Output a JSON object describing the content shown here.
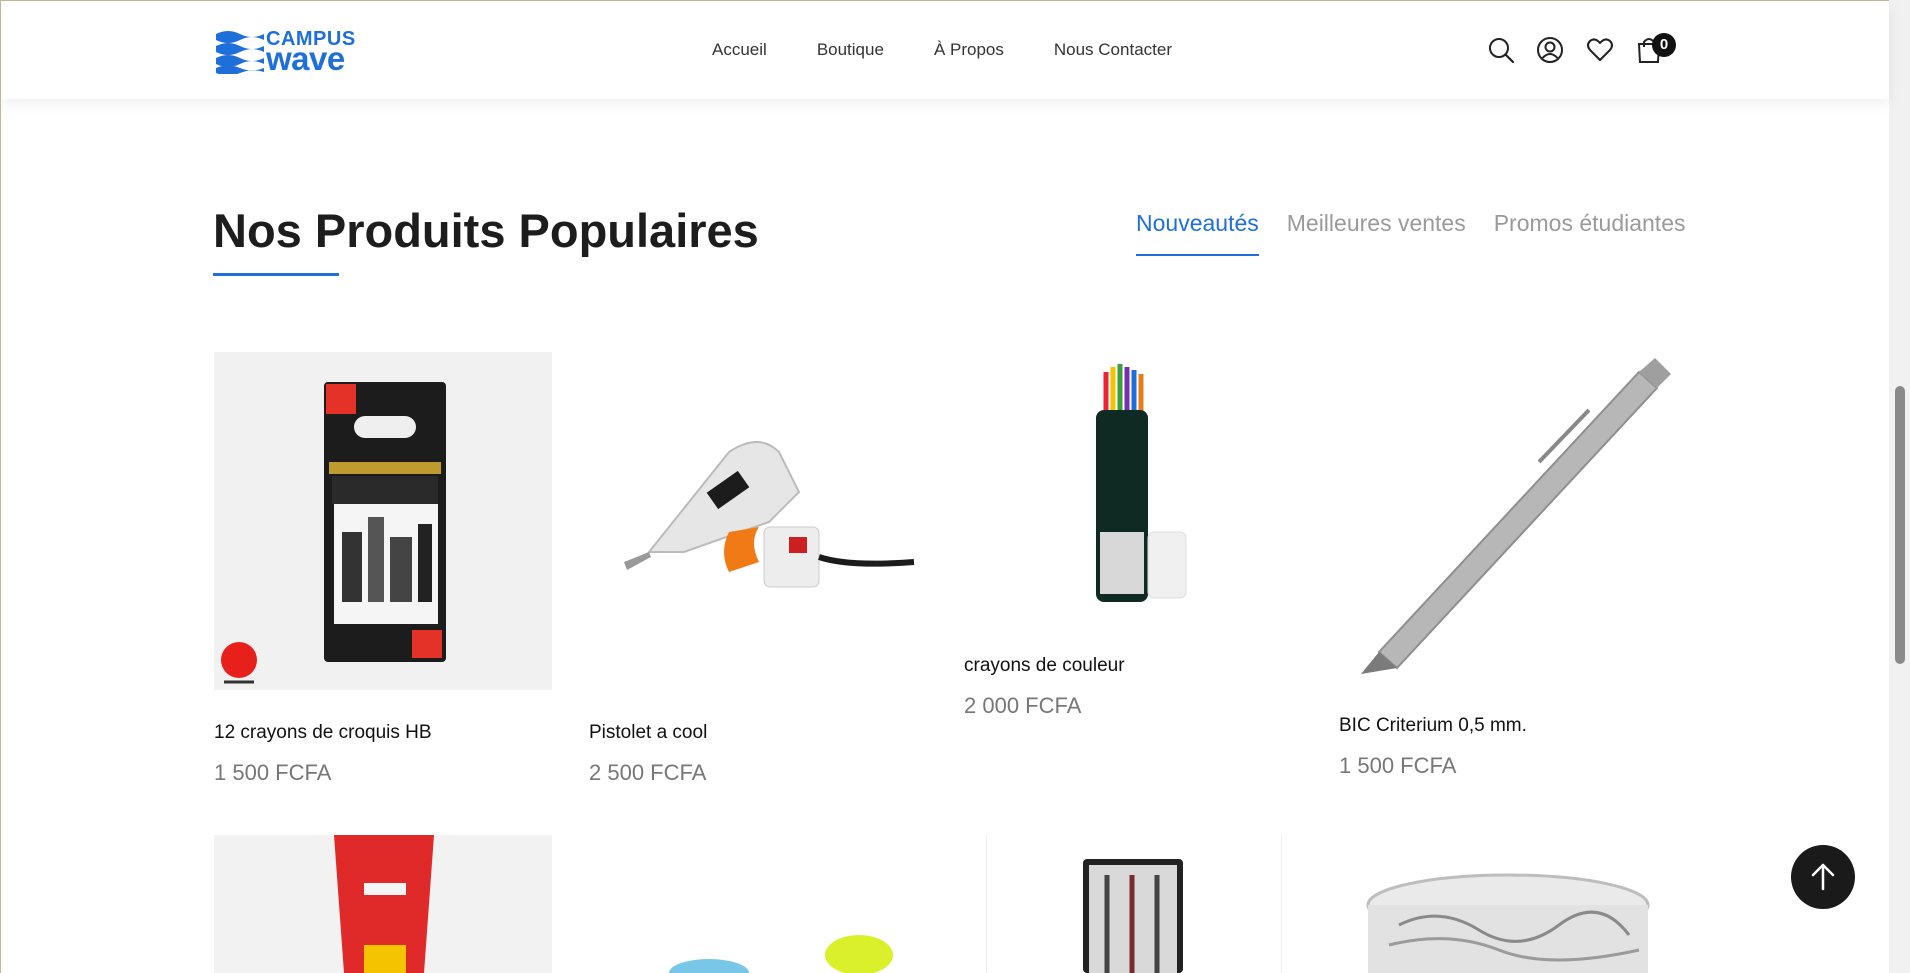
{
  "brand": {
    "line1": "CAMPUS",
    "line2": "wave",
    "color": "#1e6fd9"
  },
  "nav": [
    {
      "label": "Accueil"
    },
    {
      "label": "Boutique"
    },
    {
      "label": "À Propos"
    },
    {
      "label": "Nous Contacter"
    }
  ],
  "header_icons": [
    "search-icon",
    "user-icon",
    "heart-icon",
    "cart-icon"
  ],
  "cart": {
    "count": "0"
  },
  "section": {
    "title": "Nos Produits Populaires",
    "tabs": [
      {
        "label": "Nouveautés",
        "active": true
      },
      {
        "label": "Meilleures ventes",
        "active": false
      },
      {
        "label": "Promos étudiantes",
        "active": false
      }
    ]
  },
  "products": [
    {
      "name": "12 crayons de croquis HB",
      "price": "1 500 FCFA",
      "image": "sketching-pencils-box"
    },
    {
      "name": "Pistolet a cool",
      "price": "2 500 FCFA",
      "image": "glue-gun"
    },
    {
      "name": "crayons de couleur",
      "price": "2 000 FCFA",
      "image": "colored-pencils-tube"
    },
    {
      "name": "BIC Criterium 0,5 mm.",
      "price": "1 500 FCFA",
      "image": "mechanical-pencil"
    }
  ],
  "products_row2": [
    {
      "image": "glue-tube"
    },
    {
      "image": "erasers"
    },
    {
      "image": "compass-set"
    },
    {
      "image": "paper-clips-jar"
    }
  ],
  "accent_color": "#1e6fd9"
}
